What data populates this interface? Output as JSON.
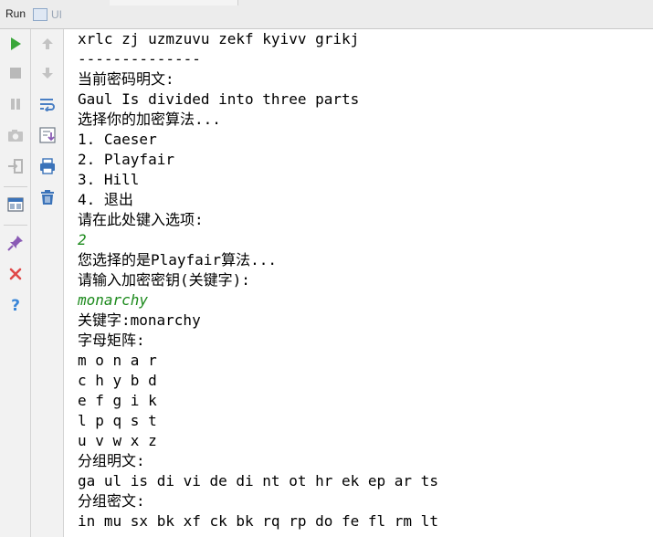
{
  "titlebar": {
    "run_label": "Run",
    "tab_label": "UI"
  },
  "toolbar": {
    "left": [
      "run-icon",
      "stop-icon",
      "pause-icon",
      "camera-icon",
      "exit-icon",
      "layout-icon",
      "pin-icon",
      "close-icon",
      "help-icon"
    ],
    "right": [
      "up-arrow-icon",
      "down-arrow-icon",
      "soft-wrap-icon",
      "scroll-end-icon",
      "print-icon",
      "trash-icon"
    ]
  },
  "console": {
    "lines": [
      {
        "text": "xrlc zj uzmzuvu zekf kyivv grikj",
        "kind": "output"
      },
      {
        "text": "--------------",
        "kind": "output"
      },
      {
        "text": "当前密码明文:",
        "kind": "output"
      },
      {
        "text": "Gaul Is divided into three parts",
        "kind": "output"
      },
      {
        "text": "选择你的加密算法...",
        "kind": "output"
      },
      {
        "text": "1. Caeser",
        "kind": "output"
      },
      {
        "text": "2. Playfair",
        "kind": "output"
      },
      {
        "text": "3. Hill",
        "kind": "output"
      },
      {
        "text": "4. 退出",
        "kind": "output"
      },
      {
        "text": "请在此处键入选项:",
        "kind": "output"
      },
      {
        "text": "2",
        "kind": "input"
      },
      {
        "text": "您选择的是Playfair算法...",
        "kind": "output"
      },
      {
        "text": "请输入加密密钥(关键字):",
        "kind": "output"
      },
      {
        "text": "monarchy",
        "kind": "input"
      },
      {
        "text": "关键字:monarchy",
        "kind": "output"
      },
      {
        "text": "字母矩阵:",
        "kind": "output"
      },
      {
        "text": "m o n a r",
        "kind": "output"
      },
      {
        "text": "c h y b d",
        "kind": "output"
      },
      {
        "text": "e f g i k",
        "kind": "output"
      },
      {
        "text": "l p q s t",
        "kind": "output"
      },
      {
        "text": "u v w x z",
        "kind": "output"
      },
      {
        "text": "分组明文:",
        "kind": "output"
      },
      {
        "text": "ga ul is di vi de di nt ot hr ek ep ar ts",
        "kind": "output"
      },
      {
        "text": "分组密文:",
        "kind": "output"
      },
      {
        "text": "in mu sx bk xf ck bk rq rp do fe fl rm lt",
        "kind": "output"
      }
    ]
  },
  "colors": {
    "input_text": "#1c8a1c",
    "run_green": "#3aa63a",
    "close_red": "#e04848",
    "help_blue": "#3a86d8"
  }
}
